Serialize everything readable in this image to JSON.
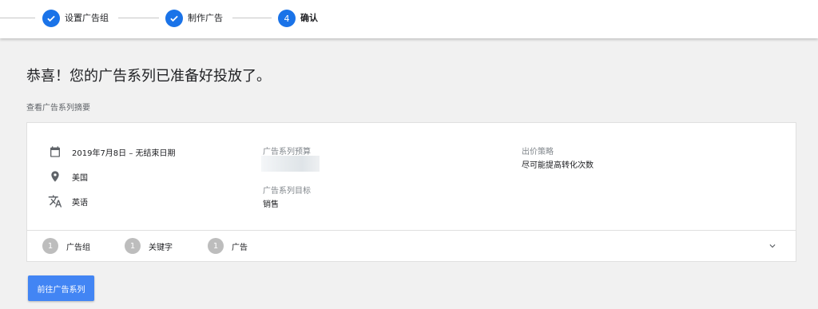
{
  "stepper": {
    "steps": [
      {
        "label": "设置广告组",
        "state": "done"
      },
      {
        "label": "制作广告",
        "state": "done"
      },
      {
        "label": "确认",
        "state": "current",
        "number": "4"
      }
    ]
  },
  "headline": "恭喜！您的广告系列已准备好投放了。",
  "summary_link": "查看广告系列摘要",
  "card": {
    "schedule": "2019年7月8日 – 无结束日期",
    "location": "美国",
    "language": "英语",
    "budget_label": "广告系列预算",
    "goal_label": "广告系列目标",
    "goal_value": "销售",
    "bidding_label": "出价策略",
    "bidding_value": "尽可能提高转化次数",
    "counts": [
      {
        "count": "1",
        "label": "广告组"
      },
      {
        "count": "1",
        "label": "关键字"
      },
      {
        "count": "1",
        "label": "广告"
      }
    ]
  },
  "cta_label": "前往广告系列",
  "colors": {
    "primary": "#4285f4",
    "step_blue": "#1a73e8",
    "badge_grey": "#bdbdbd"
  }
}
